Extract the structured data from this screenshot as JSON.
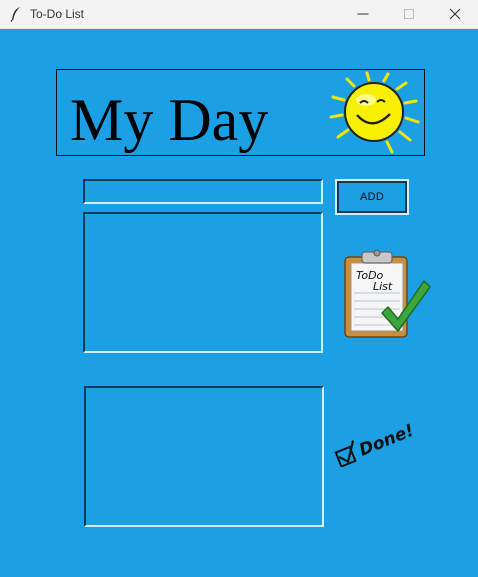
{
  "window": {
    "title": "To-Do List"
  },
  "banner": {
    "heading": "My Day",
    "sun_icon": "smiling-sun"
  },
  "task_entry": {
    "value": "",
    "placeholder": ""
  },
  "add_button": {
    "label": "ADD"
  },
  "todo_list": {
    "items": []
  },
  "done_list": {
    "items": []
  },
  "clipboard_art": {
    "line1": "ToDo",
    "line2": "List"
  },
  "done_art": {
    "text": "Done!"
  },
  "colors": {
    "background": "#1ba0e6",
    "titlebar": "#f3f3f3",
    "check": "#3ca63c"
  }
}
